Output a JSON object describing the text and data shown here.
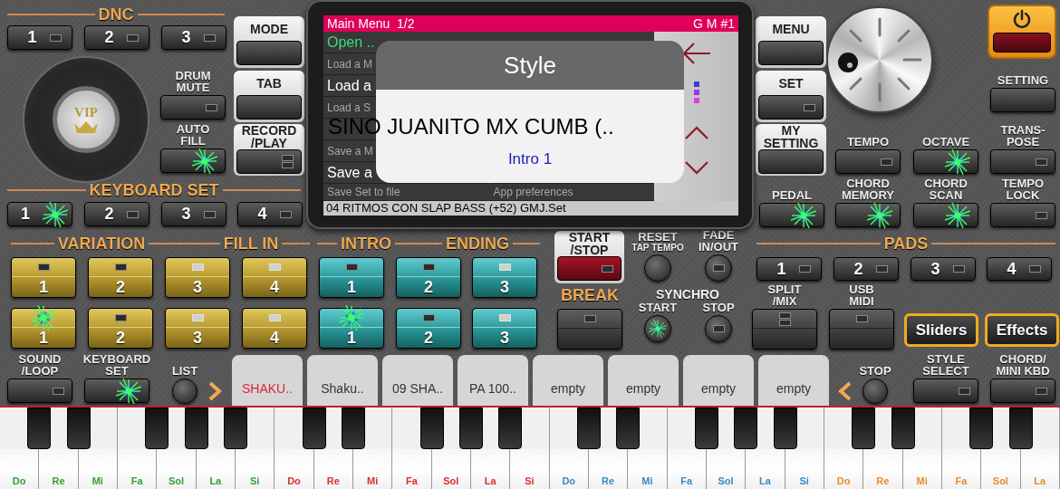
{
  "headers": [
    {
      "kind": "section",
      "label": "DNC"
    },
    {
      "kind": "section",
      "label": "KEYBOARD SET"
    },
    {
      "kind": "section",
      "label": "VARIATION"
    },
    {
      "kind": "section",
      "label": "FILL IN"
    },
    {
      "kind": "section",
      "label": "INTRO"
    },
    {
      "kind": "section",
      "label": "ENDING"
    },
    {
      "kind": "section",
      "label": "PADS"
    },
    {
      "kind": "accent",
      "label": "BREAK"
    },
    {
      "kind": "plain",
      "label": "SYNCHRO"
    }
  ],
  "logo": {
    "text": "VIP"
  },
  "buttons": [
    {
      "kind": "dark",
      "label": "1",
      "led": {
        "on": false,
        "double": false
      },
      "lit": false
    },
    {
      "kind": "dark",
      "label": "2",
      "led": {
        "on": false,
        "double": false
      },
      "lit": false
    },
    {
      "kind": "dark",
      "label": "3",
      "led": {
        "on": false,
        "double": false
      },
      "lit": false
    },
    {
      "kind": "dark",
      "caption": "DRUM\nMUTE",
      "led": {
        "on": false,
        "double": false
      },
      "lit": false
    },
    {
      "kind": "dark",
      "caption": "AUTO\nFILL",
      "lit": true
    },
    {
      "kind": "panel",
      "caption": "MODE",
      "lit": false
    },
    {
      "kind": "panel",
      "caption": "TAB",
      "lit": false
    },
    {
      "kind": "panel",
      "caption": "RECORD\n/PLAY",
      "led": {
        "on": false,
        "double": true
      },
      "lit": false
    },
    {
      "kind": "dark",
      "label": "1",
      "lit": true
    },
    {
      "kind": "dark",
      "label": "2",
      "led": {
        "on": false,
        "double": false
      },
      "lit": false
    },
    {
      "kind": "dark",
      "label": "3",
      "led": {
        "on": false,
        "double": false
      },
      "lit": false
    },
    {
      "kind": "dark",
      "label": "4",
      "led": {
        "on": false,
        "double": false
      },
      "lit": false
    },
    {
      "kind": "panel",
      "caption": "MENU",
      "lit": false
    },
    {
      "kind": "panel",
      "caption": "SET",
      "led": {
        "on": false,
        "double": false
      },
      "lit": false
    },
    {
      "kind": "panel",
      "caption": "MY\nSETTING",
      "lit": false
    },
    {
      "kind": "dark",
      "caption": "PEDAL",
      "lit": true
    },
    {
      "kind": "dark",
      "caption": "SETTING",
      "lit": false
    },
    {
      "kind": "dark",
      "caption": "TEMPO",
      "led": {
        "on": false,
        "double": false
      },
      "lit": false
    },
    {
      "kind": "dark",
      "caption": "OCTAVE",
      "lit": true
    },
    {
      "kind": "dark",
      "caption": "TRANS-\nPOSE",
      "led": {
        "on": false,
        "double": false
      },
      "lit": false
    },
    {
      "kind": "dark",
      "caption": "CHORD\nMEMORY",
      "lit": true
    },
    {
      "kind": "dark",
      "caption": "CHORD\nSCAN",
      "lit": true
    },
    {
      "kind": "dark",
      "caption": "TEMPO\nLOCK",
      "led": {
        "on": false,
        "double": false
      },
      "lit": false
    },
    {
      "kind": "gold",
      "label": "1",
      "led": {
        "on": false,
        "double": false
      },
      "lit": false
    },
    {
      "kind": "gold",
      "label": "2",
      "led": {
        "on": false,
        "double": false
      },
      "lit": false
    },
    {
      "kind": "gold",
      "label": "3",
      "led": {
        "on": true,
        "double": false
      },
      "lit": false
    },
    {
      "kind": "gold",
      "label": "4",
      "led": {
        "on": true,
        "double": false
      },
      "lit": false
    },
    {
      "kind": "teal",
      "label": "1",
      "led": {
        "on": false,
        "double": false
      },
      "lit": false
    },
    {
      "kind": "teal",
      "label": "2",
      "led": {
        "on": false,
        "double": false
      },
      "lit": false
    },
    {
      "kind": "teal",
      "label": "3",
      "led": {
        "on": true,
        "double": false
      },
      "lit": false
    },
    {
      "kind": "gold",
      "label": "1",
      "lit": true
    },
    {
      "kind": "gold",
      "label": "2",
      "led": {
        "on": false,
        "double": false
      },
      "lit": false
    },
    {
      "kind": "gold",
      "label": "3",
      "led": {
        "on": true,
        "double": false
      },
      "lit": false
    },
    {
      "kind": "gold",
      "label": "4",
      "led": {
        "on": true,
        "double": false
      },
      "lit": false
    },
    {
      "kind": "teal",
      "label": "1",
      "lit": true
    },
    {
      "kind": "teal",
      "label": "2",
      "led": {
        "on": false,
        "double": false
      },
      "lit": false
    },
    {
      "kind": "teal",
      "label": "3",
      "led": {
        "on": true,
        "double": false
      },
      "lit": false
    },
    {
      "kind": "panel_red",
      "caption": "START\n/STOP",
      "led": {
        "on": false,
        "double": false
      },
      "lit": false
    },
    {
      "kind": "dark_tall",
      "led": {
        "on": false,
        "double": false
      },
      "lit": false
    },
    {
      "kind": "round",
      "caption": "RESET",
      "subcaption": "TAP TEMPO",
      "lit": false
    },
    {
      "kind": "round",
      "caption": "FADE\nIN/OUT",
      "led": {
        "on": false,
        "double": false
      },
      "lit": false
    },
    {
      "kind": "round",
      "caption": "START",
      "lit": true
    },
    {
      "kind": "round",
      "caption": "STOP",
      "led": {
        "on": false,
        "double": false
      },
      "lit": false
    },
    {
      "kind": "dark_tall",
      "caption": "SPLIT\n/MIX",
      "led": {
        "on": false,
        "double": true
      },
      "lit": false
    },
    {
      "kind": "dark_tall",
      "caption": "USB\nMIDI",
      "led": {
        "on": false,
        "double": false
      },
      "lit": false
    },
    {
      "kind": "dark",
      "label": "1",
      "led": {
        "on": false,
        "double": false
      },
      "lit": false
    },
    {
      "kind": "dark",
      "label": "2",
      "led": {
        "on": false,
        "double": false
      },
      "lit": false
    },
    {
      "kind": "dark",
      "label": "3",
      "led": {
        "on": false,
        "double": false
      },
      "lit": false
    },
    {
      "kind": "dark",
      "label": "4",
      "led": {
        "on": false,
        "double": false
      },
      "lit": false
    },
    {
      "kind": "orange",
      "label": "Sliders",
      "lit": false
    },
    {
      "kind": "orange",
      "label": "Effects",
      "lit": false
    },
    {
      "kind": "dark",
      "caption": "SOUND\n/LOOP",
      "led": {
        "on": false,
        "double": false
      },
      "lit": false
    },
    {
      "kind": "dark",
      "caption": "KEYBOARD\nSET",
      "lit": true
    },
    {
      "kind": "round",
      "caption": "LIST",
      "lit": false
    },
    {
      "kind": "round",
      "caption": "STOP",
      "lit": false
    },
    {
      "kind": "dark",
      "caption": "STYLE\nSELECT",
      "led": {
        "on": false,
        "double": false
      },
      "lit": false
    },
    {
      "kind": "dark",
      "caption": "CHORD/\nMINI KBD",
      "led": {
        "on": false,
        "double": false
      },
      "lit": false
    }
  ],
  "screen": {
    "title": "Main Menu  1/2",
    "label": "G M #1",
    "menu_rows": [
      {
        "left": {
          "kind": "heading",
          "text": "Open .."
        }
      },
      {
        "left": {
          "kind": "hint",
          "text": "Load a M"
        }
      },
      {
        "left": {
          "kind": "item",
          "text": "Load a"
        }
      },
      {
        "left": {
          "kind": "hint",
          "text": "Load a S"
        }
      },
      {},
      {
        "left": {
          "kind": "hint",
          "text": "Save a M"
        }
      },
      {
        "left": {
          "kind": "item",
          "text": "Save a"
        }
      },
      {
        "left": {
          "kind": "hint",
          "text": "Save Set to file"
        },
        "right": {
          "kind": "hint",
          "text": "App preferences"
        }
      }
    ],
    "status": "04 RITMOS CON SLAP BASS (+52) GMJ.Set"
  },
  "dialog": {
    "title": "Style",
    "style_name": "SINO JUANITO MX CUMB (..",
    "part": "Intro 1"
  },
  "style_slots": [
    {
      "label": "SHAKU..",
      "selected": true
    },
    {
      "label": "Shaku..",
      "selected": false
    },
    {
      "label": "09 SHA..",
      "selected": false
    },
    {
      "label": "PA 100..",
      "selected": false
    },
    {
      "label": "empty",
      "selected": false
    },
    {
      "label": "empty",
      "selected": false
    },
    {
      "label": "empty",
      "selected": false
    },
    {
      "label": "empty",
      "selected": false
    }
  ],
  "keyboard": {
    "octaves": [
      {
        "color": "#35a035",
        "notes": [
          "Do",
          "Re",
          "Mi",
          "Fa",
          "Sol",
          "La",
          "Si"
        ]
      },
      {
        "color": "#d83030",
        "notes": [
          "Do",
          "Re",
          "Mi",
          "Fa",
          "Sol",
          "La",
          "Si"
        ]
      },
      {
        "color": "#3a8ac0",
        "notes": [
          "Do",
          "Re",
          "Mi",
          "Fa",
          "Sol",
          "La",
          "Si"
        ]
      },
      {
        "color": "#e88a30",
        "notes": [
          "Do",
          "Re",
          "Mi",
          "Fa",
          "Sol",
          "La"
        ]
      }
    ]
  }
}
